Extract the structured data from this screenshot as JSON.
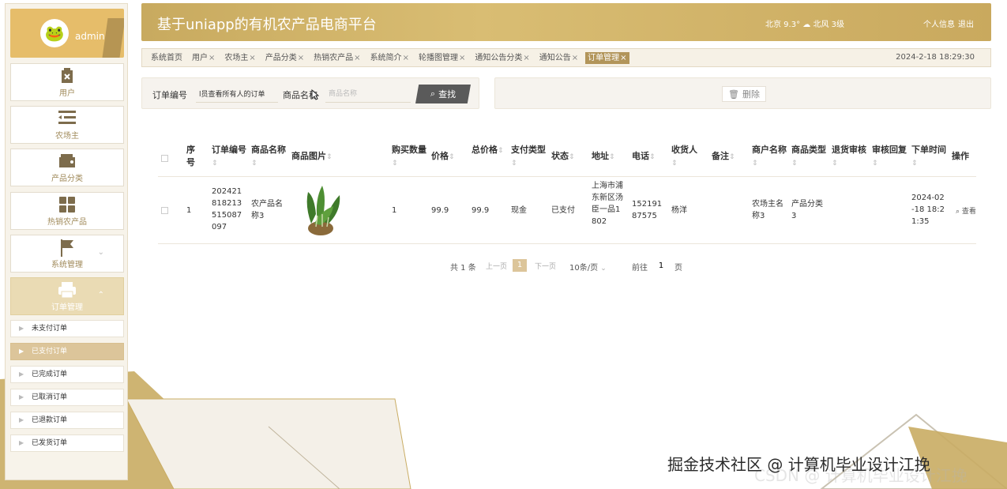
{
  "app": {
    "title": "基于uniapp的有机农产品电商平台",
    "weather": "北京  9.3°  ☁  北风  3级",
    "profile_link": "个人信息",
    "logout_link": "退出",
    "datetime": "2024-2-18 18:29:30"
  },
  "colors": {
    "accent": "#c8aa5f",
    "active_tab": "#b2955a",
    "sidebar_active": "#eadbb4",
    "sub_active": "#dcc59a"
  },
  "sidebar": {
    "username": "admin",
    "avatar_icon": "frog-avatar",
    "items": [
      {
        "label": "用户",
        "icon": "user-icon"
      },
      {
        "label": "农场主",
        "icon": "list-icon"
      },
      {
        "label": "产品分类",
        "icon": "wallet-icon"
      },
      {
        "label": "热销农产品",
        "icon": "grid-icon"
      },
      {
        "label": "系统管理",
        "icon": "flag-icon"
      },
      {
        "label": "订单管理",
        "icon": "printer-icon"
      }
    ],
    "sub_items": [
      {
        "label": "未支付订单"
      },
      {
        "label": "已支付订单"
      },
      {
        "label": "已完成订单"
      },
      {
        "label": "已取消订单"
      },
      {
        "label": "已退款订单"
      },
      {
        "label": "已发货订单"
      }
    ]
  },
  "tabs": [
    {
      "label": "系统首页",
      "closable": false
    },
    {
      "label": "用户",
      "closable": true
    },
    {
      "label": "农场主",
      "closable": true
    },
    {
      "label": "产品分类",
      "closable": true
    },
    {
      "label": "热销农产品",
      "closable": true
    },
    {
      "label": "系统简介",
      "closable": true
    },
    {
      "label": "轮播图管理",
      "closable": true
    },
    {
      "label": "通知公告分类",
      "closable": true
    },
    {
      "label": "通知公告",
      "closable": true
    },
    {
      "label": "订单管理",
      "closable": true,
      "active": true
    }
  ],
  "search": {
    "order_no_label": "订单编号",
    "order_no_value": "l员查看所有人的订单",
    "product_name_label": "商品名称",
    "product_name_placeholder": "商品名称",
    "search_button": "查找",
    "delete_button": "删除"
  },
  "table": {
    "headers": {
      "index": "序号",
      "order_no": "订单编号",
      "product_name": "商品名称",
      "product_image": "商品图片",
      "quantity": "购买数量",
      "price": "价格",
      "total": "总价格",
      "pay_type": "支付类型",
      "status": "状态",
      "address": "地址",
      "phone": "电话",
      "receiver": "收货人",
      "remark": "备注",
      "merchant_name": "商户名称",
      "product_type": "商品类型",
      "refund_review": "退货审核",
      "review_reply": "审核回复",
      "order_time": "下单时间",
      "actions": "操作"
    },
    "rows": [
      {
        "index": "1",
        "order_no": "202421818213515087097",
        "product_name": "农产品名称3",
        "quantity": "1",
        "price": "99.9",
        "total": "99.9",
        "pay_type": "现金",
        "status": "已支付",
        "address": "上海市浦东新区汤臣一品1802",
        "phone": "15219187575",
        "receiver": "杨洋",
        "remark": "",
        "merchant_name": "农场主名称3",
        "product_type": "产品分类3",
        "refund_review": "",
        "review_reply": "",
        "order_time": "2024-02-18 18:21:35",
        "view_action": "查看"
      }
    ]
  },
  "pagination": {
    "total": "共 1 条",
    "prev": "上一页",
    "current": "1",
    "next": "下一页",
    "page_size": "10条/页",
    "goto_label": "前往",
    "goto_value": "1",
    "page_unit": "页"
  },
  "watermark": "掘金技术社区 @ 计算机毕业设计江挽"
}
